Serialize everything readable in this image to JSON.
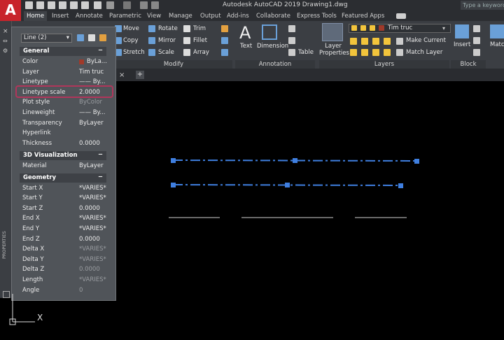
{
  "app": {
    "logo": "A",
    "title": "Autodesk AutoCAD 2019    Drawing1.dwg",
    "search_placeholder": "Type a keyword or"
  },
  "tabs": [
    "Home",
    "Insert",
    "Annotate",
    "Parametric",
    "View",
    "Manage",
    "Output",
    "Add-ins",
    "Collaborate",
    "Express Tools",
    "Featured Apps"
  ],
  "modify": {
    "move": "Move",
    "rotate": "Rotate",
    "trim": "Trim",
    "copy": "Copy",
    "mirror": "Mirror",
    "fillet": "Fillet",
    "stretch": "Stretch",
    "scale": "Scale",
    "array": "Array",
    "label": "Modify"
  },
  "annotation": {
    "text": "Text",
    "dimension": "Dimension",
    "table": "Table",
    "label": "Annotation"
  },
  "layers": {
    "layer_properties": "Layer Properties",
    "current_layer": "Tim truc",
    "make_current": "Make Current",
    "match_layer": "Match Layer",
    "label": "Layers"
  },
  "block": {
    "insert": "Insert",
    "label": "Block",
    "more": "Match Prop"
  },
  "palette": {
    "selector": "Line (2)",
    "vertical_title": "PROPERTIES",
    "general": {
      "title": "General",
      "collapse": "−",
      "rows": [
        {
          "label": "Color",
          "value": "ByLa..."
        },
        {
          "label": "Layer",
          "value": "Tim truc"
        },
        {
          "label": "Linetype",
          "value": "—— By..."
        },
        {
          "label": "Linetype scale",
          "value": "2.0000"
        },
        {
          "label": "Plot style",
          "value": "ByColor"
        },
        {
          "label": "Lineweight",
          "value": "—— By..."
        },
        {
          "label": "Transparency",
          "value": "ByLayer"
        },
        {
          "label": "Hyperlink",
          "value": ""
        },
        {
          "label": "Thickness",
          "value": "0.0000"
        }
      ]
    },
    "viz": {
      "title": "3D Visualization",
      "collapse": "−",
      "rows": [
        {
          "label": "Material",
          "value": "ByLayer"
        }
      ]
    },
    "geometry": {
      "title": "Geometry",
      "collapse": "−",
      "rows": [
        {
          "label": "Start X",
          "value": "*VARIES*"
        },
        {
          "label": "Start Y",
          "value": "*VARIES*"
        },
        {
          "label": "Start Z",
          "value": "0.0000"
        },
        {
          "label": "End X",
          "value": "*VARIES*"
        },
        {
          "label": "End Y",
          "value": "*VARIES*"
        },
        {
          "label": "End Z",
          "value": "0.0000"
        },
        {
          "label": "Delta X",
          "value": "*VARIES*"
        },
        {
          "label": "Delta Y",
          "value": "*VARIES*"
        },
        {
          "label": "Delta Z",
          "value": "0.0000"
        },
        {
          "label": "Length",
          "value": "*VARIES*"
        },
        {
          "label": "Angle",
          "value": "0"
        }
      ]
    }
  },
  "doc_tab_close": "×",
  "doc_tab_new": "+",
  "ucs": {
    "x_label": "X"
  },
  "colors": {
    "accent_line": "#3f7fe0",
    "highlight": "#b0365b",
    "app_red": "#c8242b"
  }
}
